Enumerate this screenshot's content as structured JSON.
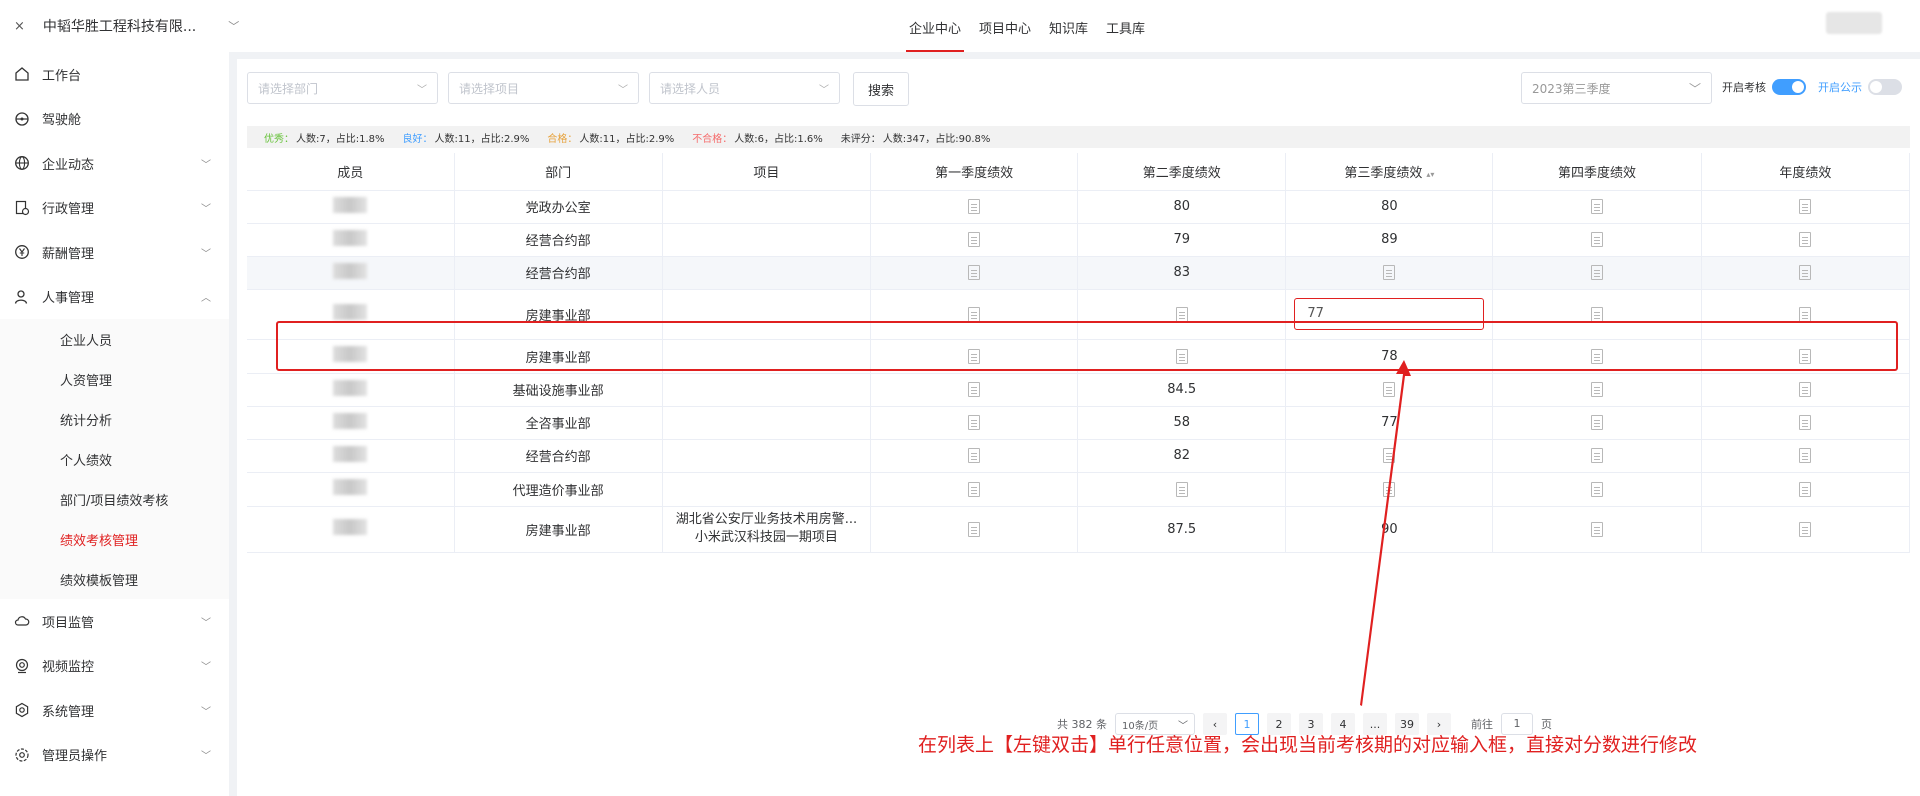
{
  "topbar": {
    "close_symbol": "×",
    "company_name": "中韬华胜工程科技有限...",
    "nav_tabs": [
      "企业中心",
      "项目中心",
      "知识库",
      "工具库"
    ],
    "active_tab": "企业中心"
  },
  "sidebar": {
    "items": [
      {
        "label": "工作台",
        "icon": "home-icon"
      },
      {
        "label": "驾驶舱",
        "icon": "steering-wheel-icon"
      },
      {
        "label": "企业动态",
        "icon": "globe-icon"
      },
      {
        "label": "行政管理",
        "icon": "admin-doc-icon"
      },
      {
        "label": "薪酬管理",
        "icon": "yen-icon"
      },
      {
        "label": "人事管理",
        "icon": "user-icon"
      }
    ],
    "subitems": [
      "企业人员",
      "人资管理",
      "统计分析",
      "个人绩效",
      "部门/项目绩效考核",
      "绩效考核管理",
      "绩效模板管理"
    ],
    "active_subitem": "绩效考核管理",
    "bottom_items": [
      {
        "label": "项目监管",
        "icon": "cloud-icon"
      },
      {
        "label": "视频监控",
        "icon": "camera-icon"
      },
      {
        "label": "系统管理",
        "icon": "gear-icon"
      },
      {
        "label": "管理员操作",
        "icon": "settings-icon"
      }
    ]
  },
  "filters": {
    "department_placeholder": "请选择部门",
    "project_placeholder": "请选择项目",
    "person_placeholder": "请选择人员",
    "search_label": "搜索",
    "quarter_value": "2023第三季度",
    "toggle_assess_label": "开启考核",
    "toggle_public_label": "开启公示",
    "toggle_assess_on": true,
    "toggle_public_on": false
  },
  "stats": [
    {
      "label": "优秀：",
      "text": "人数:7，占比:1.8%",
      "color": "#67c23a"
    },
    {
      "label": "良好：",
      "text": "人数:11，占比:2.9%",
      "color": "#409eff"
    },
    {
      "label": "合格：",
      "text": "人数:11，占比:2.9%",
      "color": "#e6a23c"
    },
    {
      "label": "不合格：",
      "text": "人数:6，占比:1.6%",
      "color": "#f56c6c"
    },
    {
      "label": "未评分：",
      "text": "人数:347，占比:90.8%",
      "color": "#303133"
    }
  ],
  "table": {
    "headers": [
      "成员",
      "部门",
      "项目",
      "第一季度绩效",
      "第二季度绩效",
      "第三季度绩效",
      "第四季度绩效",
      "年度绩效"
    ],
    "rows": [
      {
        "dept": "党政办公室",
        "project": "",
        "q2": "80",
        "q3": "80"
      },
      {
        "dept": "经营合约部",
        "project": "",
        "q2": "79",
        "q3": "89"
      },
      {
        "dept": "经营合约部",
        "project": "",
        "q2": "83",
        "q3": ""
      },
      {
        "dept": "房建事业部",
        "project": "",
        "q2": "",
        "q3": "77"
      },
      {
        "dept": "房建事业部",
        "project": "",
        "q2": "",
        "q3": "78"
      },
      {
        "dept": "基础设施事业部",
        "project": "",
        "q2": "84.5",
        "q3": ""
      },
      {
        "dept": "全咨事业部",
        "project": "",
        "q2": "58",
        "q3": "77"
      },
      {
        "dept": "经营合约部",
        "project": "",
        "q2": "82",
        "q3": ""
      },
      {
        "dept": "代理造价事业部",
        "project": "",
        "q2": "",
        "q3": ""
      },
      {
        "dept": "房建事业部",
        "project": "湖北省公安厅业务技术用房警...\n小米武汉科技园一期项目",
        "q2": "87.5",
        "q3": "90"
      }
    ]
  },
  "pagination": {
    "total": "共 382 条",
    "page_size": "10条/页",
    "pages": [
      "1",
      "2",
      "3",
      "4",
      "...",
      "39"
    ],
    "current": "1",
    "goto_prefix": "前往",
    "goto_value": "1",
    "goto_suffix": "页"
  },
  "annotation": {
    "text": "在列表上【左键双击】单行任意位置，会出现当前考核期的对应输入框，直接对分数进行修改",
    "color": "#e02020"
  }
}
